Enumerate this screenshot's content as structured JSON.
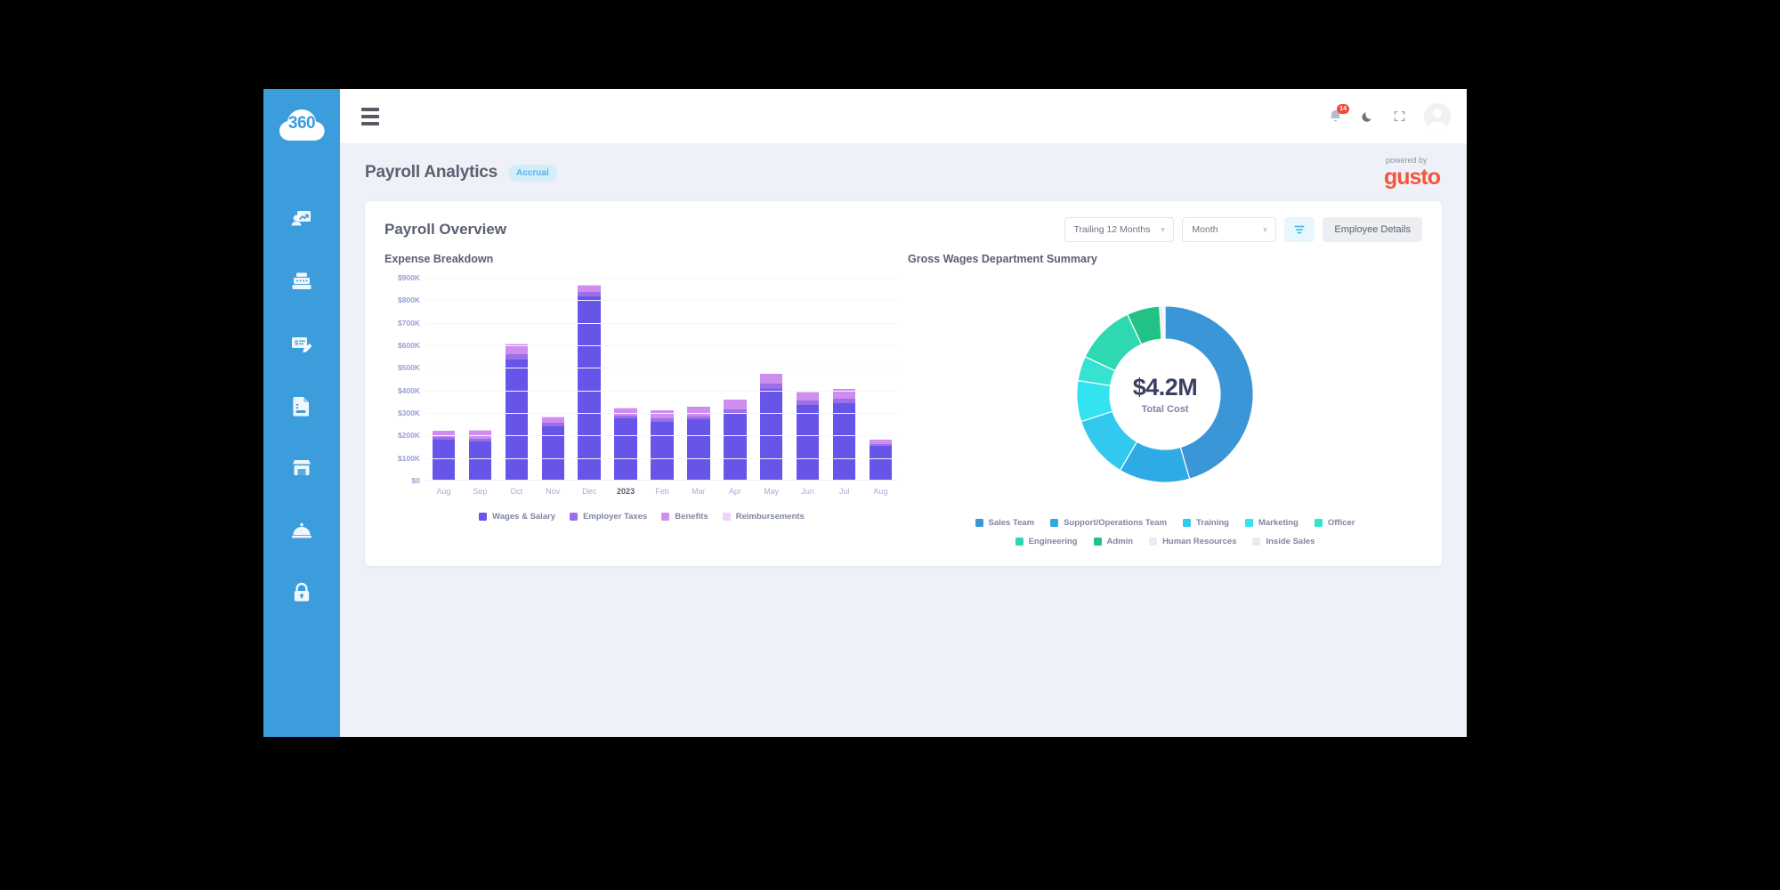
{
  "app": {
    "logo_text": "360"
  },
  "sidebar": {
    "items": [
      {
        "name": "analytics-icon",
        "label": "Analytics"
      },
      {
        "name": "register-icon",
        "label": "Register"
      },
      {
        "name": "check-edit-icon",
        "label": "Payroll Entry"
      },
      {
        "name": "document-icon",
        "label": "Documents"
      },
      {
        "name": "storefront-icon",
        "label": "Store"
      },
      {
        "name": "service-bell-icon",
        "label": "Service"
      },
      {
        "name": "lock-icon",
        "label": "Security"
      }
    ]
  },
  "topbar": {
    "menu_label": "Menu",
    "notification_count": "14",
    "dark_mode_label": "Dark mode",
    "fullscreen_label": "Fullscreen",
    "account_label": "Account"
  },
  "header": {
    "title": "Payroll Analytics",
    "badge": "Accrual",
    "powered_by": "powered by",
    "brand": "gusto"
  },
  "toolbar": {
    "range_select": "Trailing 12 Months",
    "period_select": "Month",
    "filter_label": "Filter",
    "employee_details": "Employee Details"
  },
  "card": {
    "title": "Payroll Overview"
  },
  "chart_data": [
    {
      "type": "bar",
      "title": "Expense Breakdown",
      "xlabel": "",
      "ylabel": "",
      "ylim": [
        0,
        900000
      ],
      "grid": true,
      "stacked": true,
      "yticks": [
        "$0",
        "$100K",
        "$200K",
        "$300K",
        "$400K",
        "$500K",
        "$600K",
        "$700K",
        "$800K",
        "$900K"
      ],
      "ytick_values": [
        0,
        100000,
        200000,
        300000,
        400000,
        500000,
        600000,
        700000,
        800000,
        900000
      ],
      "categories": [
        "Aug",
        "Sep",
        "Oct",
        "Nov",
        "Dec",
        "2023",
        "Feb",
        "Mar",
        "Apr",
        "May",
        "Jun",
        "Jul",
        "Aug"
      ],
      "categories_bold": [
        "2023"
      ],
      "legend_position": "bottom",
      "series": [
        {
          "name": "Wages & Salary",
          "color": "#6655e8",
          "values": [
            176000,
            168000,
            532000,
            238000,
            812000,
            272000,
            258000,
            268000,
            296000,
            404000,
            330000,
            338000,
            150000
          ]
        },
        {
          "name": "Employer Taxes",
          "color": "#9b6fe8",
          "values": [
            14000,
            12000,
            26000,
            14000,
            22000,
            14000,
            14000,
            14000,
            16000,
            22000,
            22000,
            22000,
            8000
          ]
        },
        {
          "name": "Benefits",
          "color": "#cd8ef0",
          "values": [
            26000,
            38000,
            44000,
            26000,
            28000,
            30000,
            36000,
            40000,
            42000,
            42000,
            36000,
            42000,
            18000
          ]
        },
        {
          "name": "Reimbursements",
          "color": "#edd3f8",
          "values": [
            2000,
            2000,
            2000,
            2000,
            2000,
            2000,
            2000,
            2000,
            2000,
            2000,
            2000,
            2000,
            2000
          ]
        }
      ]
    },
    {
      "type": "pie",
      "variant": "donut",
      "title": "Gross Wages Department Summary",
      "center_value": "$4.2M",
      "center_label": "Total Cost",
      "legend_position": "bottom",
      "labels": [
        "Sales Team",
        "Support/Operations Team",
        "Training",
        "Marketing",
        "Officer",
        "Engineering",
        "Admin",
        "Human Resources",
        "Inside Sales"
      ],
      "values": [
        45.5,
        13.0,
        11.5,
        7.5,
        4.5,
        11.0,
        6.0,
        0.6,
        0.4
      ],
      "colors": [
        "#3b96d8",
        "#2eaae4",
        "#33c9ef",
        "#33e3f0",
        "#37e2d0",
        "#2ed8b0",
        "#22c286",
        "#e9ebee",
        "#e9ebee"
      ]
    }
  ]
}
